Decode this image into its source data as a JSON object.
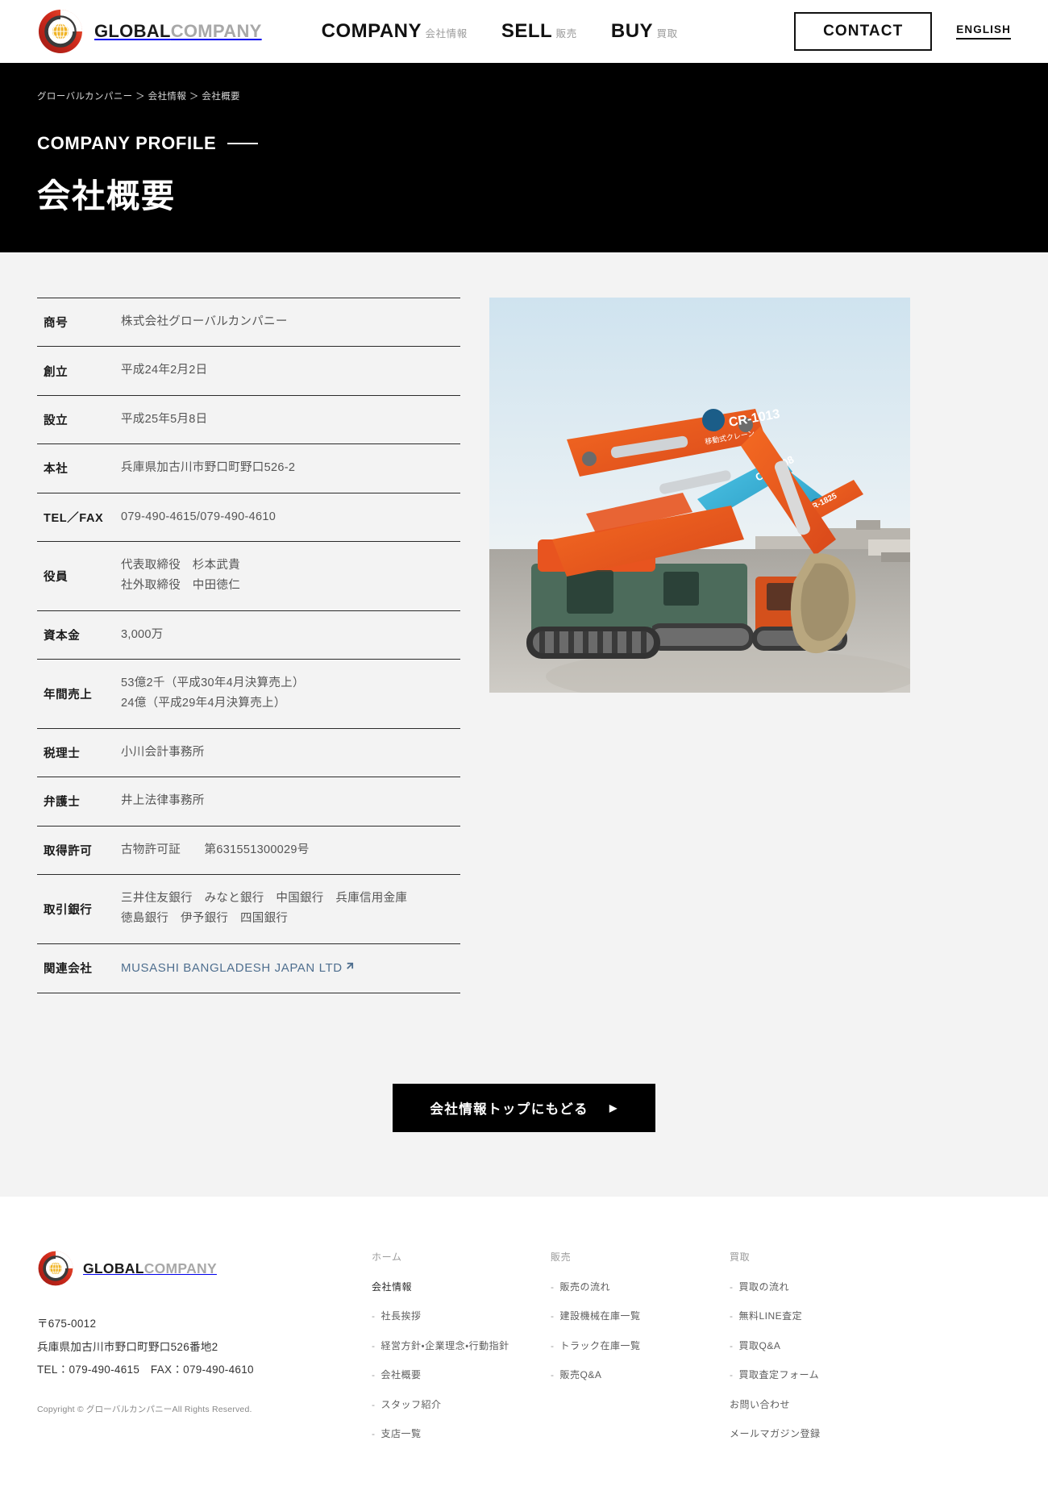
{
  "header": {
    "brand": {
      "strong": "GLOBAL",
      "light": "COMPANY",
      "logo_icon": "globe-target-logo-icon"
    },
    "nav": [
      {
        "en": "COMPANY",
        "ja": "会社情報"
      },
      {
        "en": "SELL",
        "ja": "販売"
      },
      {
        "en": "BUY",
        "ja": "買取"
      }
    ],
    "contact_label": "CONTACT",
    "language_label": "ENGLISH"
  },
  "hero": {
    "breadcrumb": "グローバルカンパニー ＞ 会社情報 ＞ 会社概要",
    "title_en": "COMPANY PROFILE",
    "title_ja": "会社概要"
  },
  "profile": {
    "rows": [
      {
        "label": "商号",
        "value": "株式会社グローバルカンパニー"
      },
      {
        "label": "創立",
        "value": "平成24年2月2日"
      },
      {
        "label": "設立",
        "value": "平成25年5月8日"
      },
      {
        "label": "本社",
        "value": "兵庫県加古川市野口町野口526-2"
      },
      {
        "label": "TEL／FAX",
        "value": "079-490-4615/079-490-4610"
      },
      {
        "label": "役員",
        "value": "代表取締役　杉本武貴\n社外取締役　中田徳仁"
      },
      {
        "label": "資本金",
        "value": "3,000万"
      },
      {
        "label": "年間売上",
        "value": "53億2千（平成30年4月決算売上）\n24億（平成29年4月決算売上）"
      },
      {
        "label": "税理士",
        "value": "小川会計事務所"
      },
      {
        "label": "弁護士",
        "value": "井上法律事務所"
      },
      {
        "label": "取得許可",
        "value": "古物許可証　　第631551300029号"
      },
      {
        "label": "取引銀行",
        "value": "三井住友銀行　みなと銀行　中国銀行　兵庫信用金庫\n徳島銀行　伊予銀行　四国銀行"
      }
    ],
    "affiliate_row": {
      "label": "関連会社",
      "link_text": "MUSASHI BANGLADESH JAPAN LTD",
      "external_icon": "external-link-icon"
    }
  },
  "photo": {
    "alt_name": "excavator-lineup-photo",
    "machine_labels": [
      "CR-1013",
      "移動式クレーン",
      "CR-7008",
      "CR-1825"
    ]
  },
  "back_button": {
    "label": "会社情報トップにもどる",
    "arrow": "▶"
  },
  "footer": {
    "brand": {
      "strong": "GLOBAL",
      "light": "COMPANY",
      "logo_icon": "globe-target-logo-icon"
    },
    "postal": "〒675-0012",
    "address": "兵庫県加古川市野口町野口526番地2",
    "tel_fax": "TEL：079-490-4615　FAX：079-490-4610",
    "copyright": "Copyright © グローバルカンパニーAll Rights Reserved.",
    "columns": [
      {
        "head": "ホーム",
        "links": [
          {
            "text": "会社情報",
            "dash": false,
            "strong": true
          },
          {
            "text": "社長挨拶",
            "dash": true,
            "strong": false
          },
          {
            "text": "経営方針・企業理念・行動指針",
            "dash": true,
            "strong": false
          },
          {
            "text": "会社概要",
            "dash": true,
            "strong": false
          },
          {
            "text": "スタッフ紹介",
            "dash": true,
            "strong": false
          },
          {
            "text": "支店一覧",
            "dash": true,
            "strong": false
          }
        ]
      },
      {
        "head": "販売",
        "links": [
          {
            "text": "販売の流れ",
            "dash": true,
            "strong": false
          },
          {
            "text": "建設機械在庫一覧",
            "dash": true,
            "strong": false
          },
          {
            "text": "トラック在庫一覧",
            "dash": true,
            "strong": false
          },
          {
            "text": "販売Q&A",
            "dash": true,
            "strong": false
          }
        ]
      },
      {
        "head": "買取",
        "links": [
          {
            "text": "買取の流れ",
            "dash": true,
            "strong": false
          },
          {
            "text": "無料LINE査定",
            "dash": true,
            "strong": false
          },
          {
            "text": "買取Q&A",
            "dash": true,
            "strong": false
          },
          {
            "text": "買取査定フォーム",
            "dash": true,
            "strong": false
          },
          {
            "text": "お問い合わせ",
            "dash": false,
            "strong": false
          },
          {
            "text": "メールマガジン登録",
            "dash": false,
            "strong": false
          }
        ]
      }
    ]
  },
  "colors": {
    "hero_bg": "#000000",
    "main_bg": "#f3f3f3",
    "logo_red": "#c0392b",
    "logo_orange": "#e8541f",
    "logo_yellow": "#f0b323",
    "link_blue": "#4f6f8f"
  }
}
